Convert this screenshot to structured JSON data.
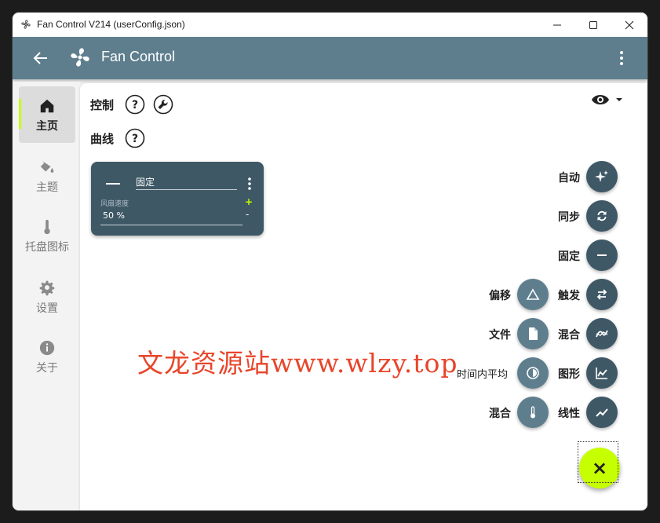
{
  "window": {
    "title": "Fan Control V214 (userConfig.json)",
    "minimize": "minimize",
    "maximize": "maximize",
    "close": "close"
  },
  "appbar": {
    "title": "Fan Control"
  },
  "sidebar": {
    "items": [
      {
        "label": "主页",
        "icon": "home-icon"
      },
      {
        "label": "主题",
        "icon": "paint-bucket-icon"
      },
      {
        "label": "托盘图标",
        "icon": "thermometer-icon"
      },
      {
        "label": "设置",
        "icon": "gear-icon"
      },
      {
        "label": "关于",
        "icon": "info-icon"
      }
    ]
  },
  "main": {
    "controls_label": "控制",
    "curves_label": "曲线",
    "card": {
      "name": "固定",
      "speed_label": "风扇速度",
      "speed_value": "50 %",
      "plus": "+",
      "minus": "-"
    }
  },
  "fab_menu": {
    "right_column": [
      {
        "label": "自动",
        "icon": "sparkle-icon"
      },
      {
        "label": "同步",
        "icon": "sync-icon"
      },
      {
        "label": "固定",
        "icon": "minus-icon"
      },
      {
        "label": "触发",
        "icon": "swap-icon"
      },
      {
        "label": "混合",
        "icon": "mix-curve-icon"
      },
      {
        "label": "图形",
        "icon": "graph-icon"
      },
      {
        "label": "线性",
        "icon": "linear-icon"
      }
    ],
    "left_column": [
      {
        "label": "偏移",
        "icon": "triangle-icon"
      },
      {
        "label": "文件",
        "icon": "file-icon"
      },
      {
        "label": "时间内平均",
        "icon": "clock-icon"
      },
      {
        "label": "混合",
        "icon": "thermometer-icon"
      }
    ],
    "close_label": "×"
  },
  "watermark": "文龙资源站www.wlzy.top",
  "colors": {
    "accent": "#c6ff00",
    "appbar": "#5e7e8e",
    "card": "#3f5866"
  }
}
